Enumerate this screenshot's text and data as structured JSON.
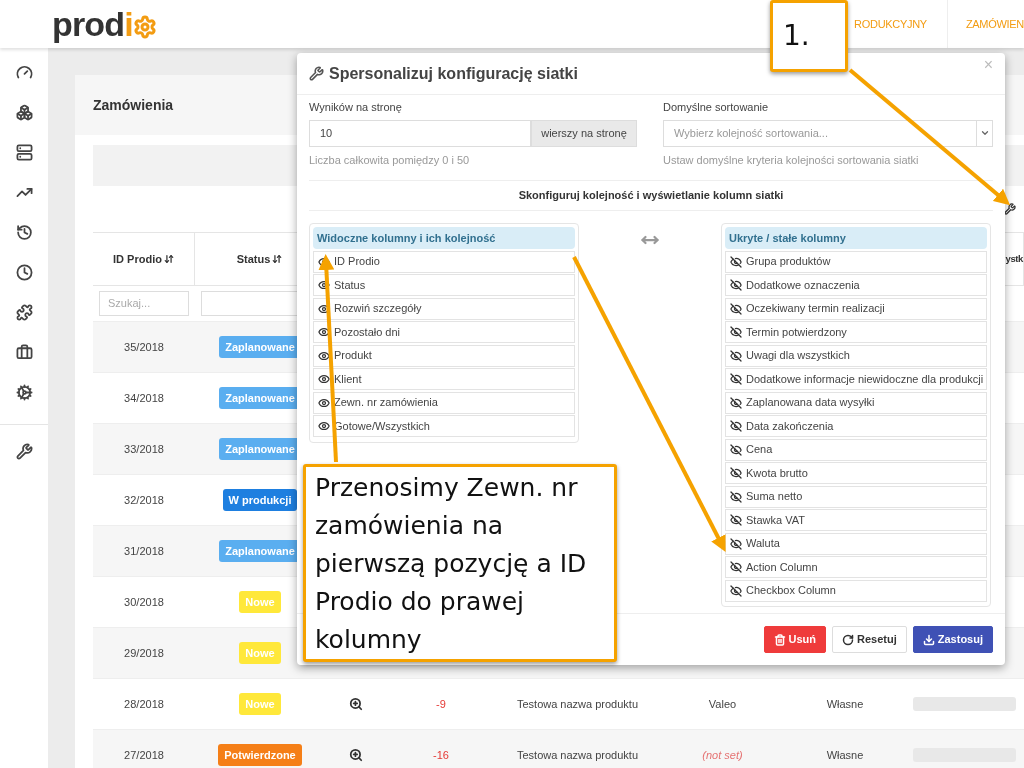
{
  "header": {
    "logo": {
      "dark": "prod",
      "accent": "i"
    },
    "nav": [
      {
        "label": "RODUKCYJNY",
        "selected": false
      },
      {
        "label": "ZAMÓWIEN",
        "selected": false
      }
    ]
  },
  "page": {
    "title": "Zamówienia"
  },
  "table": {
    "columns": [
      {
        "label": "ID Prodio",
        "sortable": true,
        "filter_placeholder": "Szukaj..."
      },
      {
        "label": "Status",
        "sortable": true
      }
    ],
    "column_cut": "ystk",
    "rows": [
      {
        "id": "35/2018",
        "status": {
          "label": "Zaplanowane",
          "kind": "planned"
        }
      },
      {
        "id": "34/2018",
        "status": {
          "label": "Zaplanowane",
          "kind": "planned"
        }
      },
      {
        "id": "33/2018",
        "status": {
          "label": "Zaplanowane",
          "kind": "planned"
        }
      },
      {
        "id": "32/2018",
        "status": {
          "label": "W produkcji",
          "kind": "production"
        }
      },
      {
        "id": "31/2018",
        "status": {
          "label": "Zaplanowane",
          "kind": "planned"
        }
      },
      {
        "id": "30/2018",
        "status": {
          "label": "Nowe",
          "kind": "new"
        }
      },
      {
        "id": "29/2018",
        "status": {
          "label": "Nowe",
          "kind": "new"
        }
      },
      {
        "id": "28/2018",
        "status": {
          "label": "Nowe",
          "kind": "new"
        },
        "details": {
          "days": "-9",
          "product": "Testowa nazwa produktu",
          "client": "Valeo",
          "client_set": true,
          "type": "Własne",
          "level": 0
        }
      },
      {
        "id": "27/2018",
        "status": {
          "label": "Potwierdzone",
          "kind": "confirmed"
        },
        "details": {
          "days": "-16",
          "product": "Testowa nazwa produktu",
          "client": "(not set)",
          "client_set": false,
          "type": "Własne",
          "level": 0
        }
      }
    ]
  },
  "modal": {
    "title": "Spersonalizuj konfigurację siatki",
    "close": "×",
    "per_page": {
      "label": "Wyników na stronę",
      "value": "10",
      "addon": "wierszy na stronę",
      "help": "Liczba całkowita pomiędzy 0 i 50"
    },
    "sorting": {
      "label": "Domyślne sortowanie",
      "placeholder": "Wybierz kolejność sortowania...",
      "help": "Ustaw domyślne kryteria kolejności sortowania siatki"
    },
    "section_title": "Skonfiguruj kolejność i wyświetlanie kolumn siatki",
    "visible": {
      "title": "Widoczne kolumny i ich kolejność",
      "items": [
        {
          "label": "ID Prodio",
          "visible": true
        },
        {
          "label": "Status",
          "visible": true
        },
        {
          "label": "Rozwiń szczegóły",
          "visible": true
        },
        {
          "label": "Pozostało dni",
          "visible": true
        },
        {
          "label": "Produkt",
          "visible": true
        },
        {
          "label": "Klient",
          "visible": true
        },
        {
          "label": "Zewn. nr zamówienia",
          "visible": true
        },
        {
          "label": "Gotowe/Wszystkich",
          "visible": true
        }
      ]
    },
    "hidden": {
      "title": "Ukryte / stałe kolumny",
      "items": [
        {
          "label": "Grupa produktów",
          "visible": false
        },
        {
          "label": "Dodatkowe oznaczenia",
          "visible": false
        },
        {
          "label": "Oczekiwany termin realizacji",
          "visible": false
        },
        {
          "label": "Termin potwierdzony",
          "visible": false
        },
        {
          "label": "Uwagi dla wszystkich",
          "visible": false
        },
        {
          "label": "Dodatkowe informacje niewidoczne dla produkcji",
          "visible": false
        },
        {
          "label": "Zaplanowana data wysyłki",
          "visible": false
        },
        {
          "label": "Data zakończenia",
          "visible": false
        },
        {
          "label": "Cena",
          "visible": false
        },
        {
          "label": "Kwota brutto",
          "visible": false
        },
        {
          "label": "Suma netto",
          "visible": false
        },
        {
          "label": "Stawka VAT",
          "visible": false
        },
        {
          "label": "Waluta",
          "visible": false
        },
        {
          "label": "Action Column",
          "visible": false
        },
        {
          "label": "Checkbox Column",
          "visible": false
        }
      ]
    },
    "buttons": [
      {
        "label": "Usuń",
        "kind": "danger"
      },
      {
        "label": "Resetuj",
        "kind": "default"
      },
      {
        "label": "Zastosuj",
        "kind": "primary"
      }
    ]
  },
  "annotations": [
    {
      "text": "1.",
      "kind": "step"
    },
    {
      "text": "Przenosimy Zewn. nr zamówienia na pierwszą pozycję a ID Prodio do prawej kolumny",
      "kind": "note"
    }
  ]
}
